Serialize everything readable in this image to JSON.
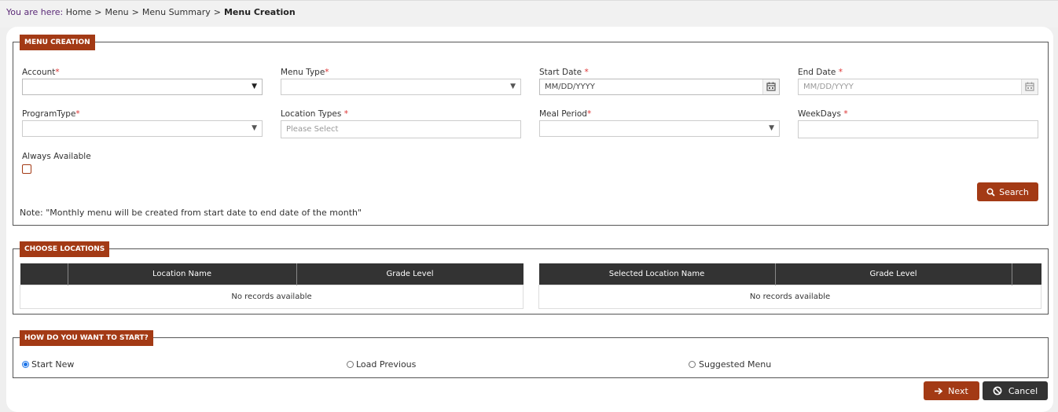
{
  "breadcrumb": {
    "prefix": "You are here:",
    "items": [
      "Home",
      "Menu",
      "Menu Summary"
    ],
    "separator": ">",
    "current": "Menu Creation"
  },
  "menu_creation": {
    "legend": "MENU CREATION",
    "account": {
      "label": "Account",
      "value": ""
    },
    "menu_type": {
      "label": "Menu Type",
      "value": ""
    },
    "start_date": {
      "label": "Start Date",
      "placeholder": "MM/DD/YYYY"
    },
    "end_date": {
      "label": "End Date",
      "placeholder": "MM/DD/YYYY"
    },
    "program_type": {
      "label": "ProgramType",
      "value": ""
    },
    "location_types": {
      "label": "Location Types",
      "placeholder": "Please Select"
    },
    "meal_period": {
      "label": "Meal Period",
      "value": ""
    },
    "weekdays": {
      "label": "WeekDays",
      "value": ""
    },
    "always_available": {
      "label": "Always Available",
      "checked": false
    },
    "required_mark": "*",
    "search_label": "Search",
    "note": "Note: \"Monthly menu will be created from start date to end date of the month\""
  },
  "choose_locations": {
    "legend": "CHOOSE LOCATIONS",
    "left_table": {
      "columns": [
        "",
        "Location Name",
        "Grade Level"
      ],
      "empty": "No records available"
    },
    "right_table": {
      "columns": [
        "Selected Location Name",
        "Grade Level",
        ""
      ],
      "empty": "No records available"
    }
  },
  "how_to_start": {
    "legend": "HOW DO YOU WANT TO START?",
    "options": [
      {
        "label": "Start New",
        "checked": true
      },
      {
        "label": "Load Previous",
        "checked": false
      },
      {
        "label": "Suggested Menu",
        "checked": false
      }
    ]
  },
  "footer": {
    "next_label": "Next",
    "cancel_label": "Cancel"
  },
  "colors": {
    "brand": "#a33a15",
    "header_dark": "#333333",
    "radio_selected": "#1a73e8",
    "required": "#dd3333"
  },
  "icons": {
    "search": "search-icon",
    "calendar": "calendar-icon",
    "next": "arrow-right-icon",
    "cancel": "ban-icon",
    "caret": "chevron-down-icon"
  }
}
